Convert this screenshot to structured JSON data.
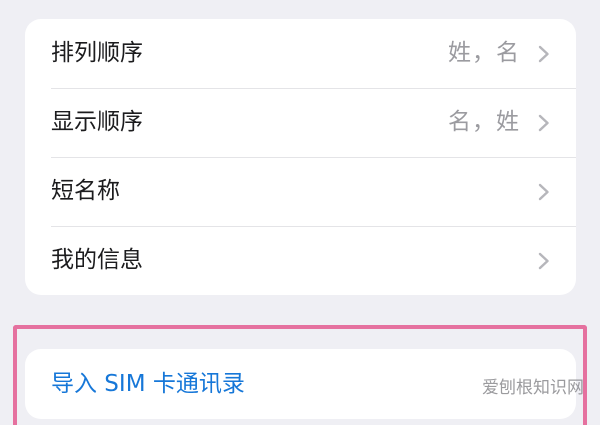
{
  "settings": {
    "rows": [
      {
        "label": "排列顺序",
        "value": "姓，名"
      },
      {
        "label": "显示顺序",
        "value": "名，姓"
      },
      {
        "label": "短名称",
        "value": ""
      },
      {
        "label": "我的信息",
        "value": ""
      }
    ]
  },
  "import": {
    "label": "导入 SIM 卡通讯录"
  },
  "watermark": "爱刨根知识网",
  "icons": {
    "chevron": "chevron-right-icon"
  },
  "colors": {
    "background": "#efeff4",
    "action_blue": "#1677d8",
    "highlight_pink": "#e5719f",
    "secondary_gray": "#9b9ba0"
  }
}
